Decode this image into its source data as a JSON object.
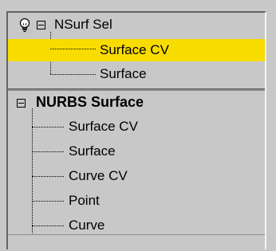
{
  "groups": [
    {
      "title": "NSurf Sel",
      "items": [
        {
          "label": "Surface CV",
          "selected": true
        },
        {
          "label": "Surface",
          "selected": false
        }
      ]
    },
    {
      "title": "NURBS Surface",
      "items": [
        {
          "label": "Surface CV"
        },
        {
          "label": "Surface"
        },
        {
          "label": "Curve CV"
        },
        {
          "label": "Point"
        },
        {
          "label": "Curve"
        }
      ]
    }
  ],
  "colors": {
    "selection": "#f8dc00",
    "background": "#c8c8c8"
  },
  "icons": [
    "lightbulb-icon",
    "collapse-icon"
  ]
}
